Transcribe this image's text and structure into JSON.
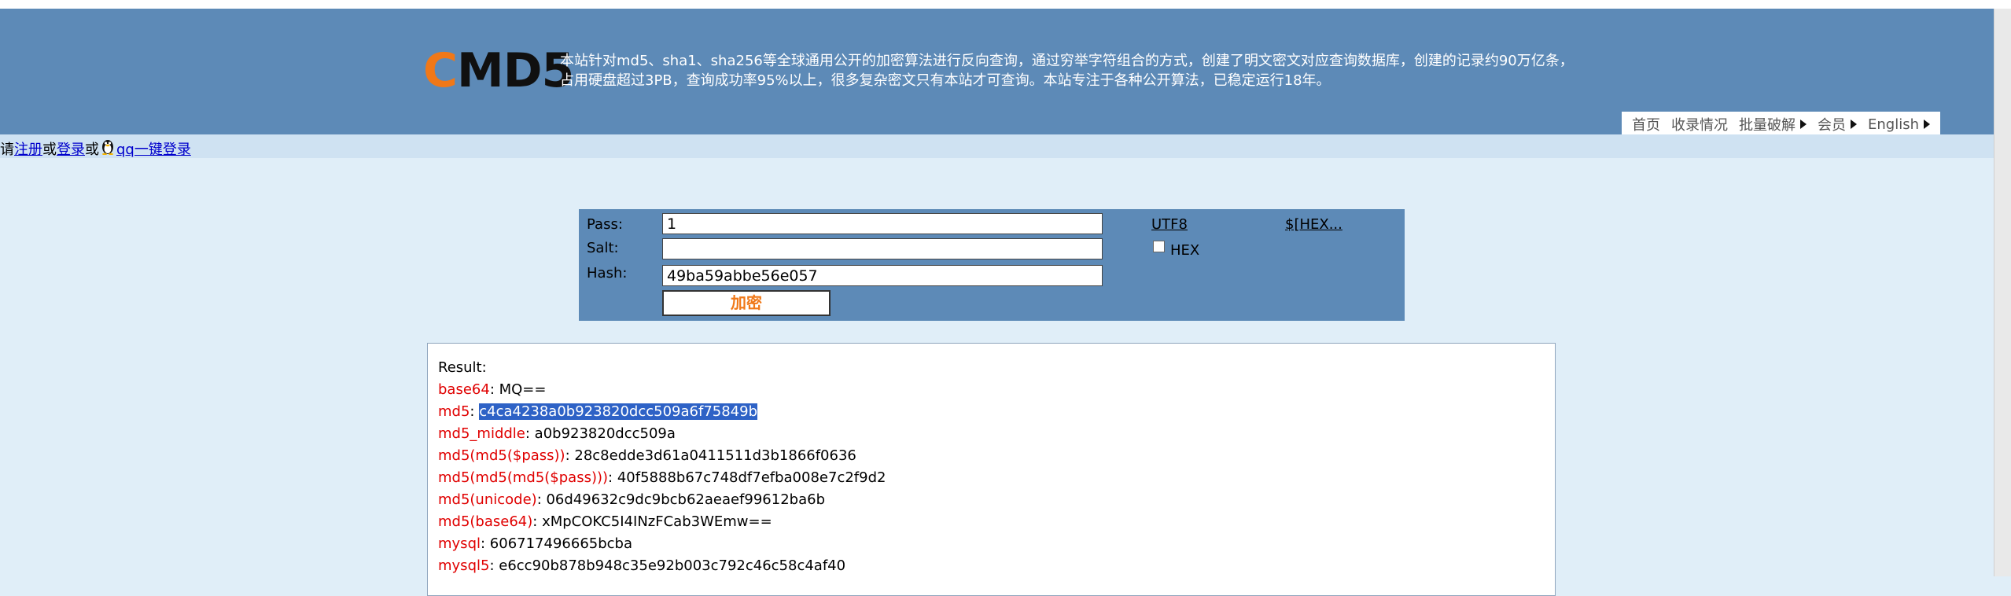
{
  "site": {
    "logo_c": "C",
    "logo_rest": "MD5",
    "intro_line1": "本站针对md5、sha1、sha256等全球通用公开的加密算法进行反向查询，通过穷举字符组合的方式，创建了明文密文对应查询数据库，创建的记录约90万亿条，",
    "intro_line2": "占用硬盘超过3PB，查询成功率95%以上，很多复杂密文只有本站才可查询。本站专注于各种公开算法，已稳定运行18年。"
  },
  "nav": {
    "home": "首页",
    "records": "收录情况",
    "batch": "批量破解",
    "member": "会员",
    "english": "English"
  },
  "login": {
    "prefix": "请",
    "register": "注册",
    "or1": "或",
    "login": "登录",
    "or2": "或",
    "qq_login": "qq一键登录"
  },
  "form": {
    "pass_label": "Pass:",
    "pass_value": "1",
    "salt_label": "Salt:",
    "salt_value": "",
    "hash_label": "Hash:",
    "hash_value": "49ba59abbe56e057",
    "utf8_link": "UTF8",
    "hex_link": "$[HEX...",
    "hex_checkbox_label": "HEX",
    "hex_checked": false,
    "encrypt_button": "加密"
  },
  "result": {
    "title": "Result:",
    "rows": [
      {
        "key": "base64",
        "value": "MQ==",
        "highlighted": false
      },
      {
        "key": "md5",
        "value": "c4ca4238a0b923820dcc509a6f75849b",
        "highlighted": true
      },
      {
        "key": "md5_middle",
        "value": "a0b923820dcc509a",
        "highlighted": false
      },
      {
        "key": "md5(md5($pass))",
        "value": "28c8edde3d61a0411511d3b1866f0636",
        "highlighted": false
      },
      {
        "key": "md5(md5(md5($pass)))",
        "value": "40f5888b67c748df7efba008e7c2f9d2",
        "highlighted": false
      },
      {
        "key": "md5(unicode)",
        "value": "06d49632c9dc9bcb62aeaef99612ba6b",
        "highlighted": false
      },
      {
        "key": "md5(base64)",
        "value": "xMpCOKC5I4INzFCab3WEmw==",
        "highlighted": false
      },
      {
        "key": "mysql",
        "value": "606717496665bcba",
        "highlighted": false
      },
      {
        "key": "mysql5",
        "value": "e6cc90b878b948c35e92b003c792c46c58c4af40",
        "highlighted": false
      }
    ],
    "separator": ": "
  },
  "colors": {
    "header_bg": "#5d8ab7",
    "page_bg": "#e0eef8",
    "accent_orange": "#f07818",
    "result_key_red": "#e00000",
    "selection_blue": "#2e62c6"
  }
}
